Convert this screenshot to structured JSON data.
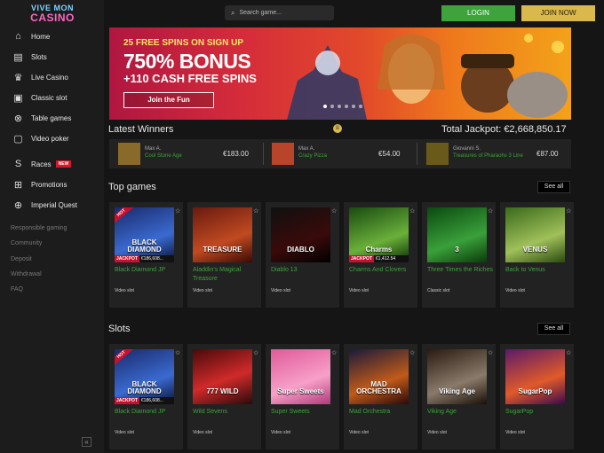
{
  "logo": {
    "line1": "VIVE MON",
    "line2": "CASINO"
  },
  "sidebar": {
    "items": [
      {
        "label": "Home",
        "icon": "home-icon",
        "glyph": "⌂"
      },
      {
        "label": "Slots",
        "icon": "slots-icon",
        "glyph": "▤"
      },
      {
        "label": "Live Casino",
        "icon": "live-casino-icon",
        "glyph": "♛"
      },
      {
        "label": "Classic slot",
        "icon": "classic-slot-icon",
        "glyph": "▣"
      },
      {
        "label": "Table games",
        "icon": "table-games-icon",
        "glyph": "⊗"
      },
      {
        "label": "Video poker",
        "icon": "video-poker-icon",
        "glyph": "▢"
      },
      {
        "label": "Races",
        "icon": "races-icon",
        "glyph": "S",
        "badge": "NEW"
      },
      {
        "label": "Promotions",
        "icon": "gift-icon",
        "glyph": "⊞"
      },
      {
        "label": "Imperial Quest",
        "icon": "quest-icon",
        "glyph": "⊕"
      }
    ],
    "links": [
      "Responsible gaming",
      "Community",
      "Deposit",
      "Withdrawal",
      "FAQ"
    ],
    "collapse_glyph": "«"
  },
  "header": {
    "search_placeholder": "Search game...",
    "login_label": "LOGIN",
    "join_label": "JOIN NOW"
  },
  "banner": {
    "line1": "25 FREE SPINS ON SIGN UP",
    "line2": "750% BONUS",
    "line3": "+110 CASH FREE SPINS",
    "cta": "Join the Fun",
    "slide_count": 6,
    "active_slide": 0
  },
  "winners": {
    "title": "Latest Winners",
    "jackpot_label": "Total Jackpot: €2,668,850.17",
    "items": [
      {
        "name": "Max A.",
        "game": "Cool Stone Age",
        "amount": "€183.00"
      },
      {
        "name": "Max A.",
        "game": "Crazy Pizza",
        "amount": "€54.00"
      },
      {
        "name": "Giovanni S.",
        "game": "Treasures of Pharaohs 3 Line",
        "amount": "€87.00"
      }
    ]
  },
  "top_games": {
    "title": "Top games",
    "see_all": "See all",
    "cards": [
      {
        "name": "Black Diamond JP",
        "type": "Video slot",
        "hot": "HOT",
        "jackpot": "€186,608...",
        "art": "BLACK DIAMOND"
      },
      {
        "name": "Aladdin's Magical Treasure",
        "type": "Video slot",
        "art": "TREASURE"
      },
      {
        "name": "Diablo 13",
        "type": "Video slot",
        "art": "DIABLO"
      },
      {
        "name": "Charms And Clovers",
        "type": "Video slot",
        "jackpot": "€1,412.54",
        "art": "Charms"
      },
      {
        "name": "Three Times the Riches",
        "type": "Classic slot",
        "art": "3"
      },
      {
        "name": "Back to Venus",
        "type": "Video slot",
        "art": "VENUS"
      }
    ]
  },
  "slots": {
    "title": "Slots",
    "see_all": "See all",
    "cards": [
      {
        "name": "Black Diamond JP",
        "type": "Video slot",
        "hot": "HOT",
        "jackpot": "€186,608...",
        "art": "BLACK DIAMOND"
      },
      {
        "name": "Wild Sevens",
        "type": "Video slot",
        "art": "777 WILD"
      },
      {
        "name": "Super Sweets",
        "type": "Video slot",
        "art": "Super Sweets"
      },
      {
        "name": "Mad Orchestra",
        "type": "Video slot",
        "art": "MAD ORCHESTRA"
      },
      {
        "name": "Viking Age",
        "type": "Video slot",
        "art": "Viking Age"
      },
      {
        "name": "SugarPop",
        "type": "Video slot",
        "art": "SugarPop"
      }
    ]
  },
  "jackpot_label": "JACKPOT",
  "favorite_glyph": "☆",
  "colors": {
    "accent_green": "#3da33a",
    "accent_gold": "#d9b84c",
    "hot_red": "#c8102e",
    "bg": "#151515"
  }
}
